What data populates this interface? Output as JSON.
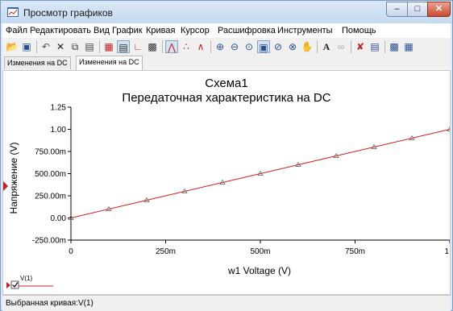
{
  "window": {
    "title": "Просмотр графиков"
  },
  "menu": [
    "Файл",
    "Редактировать",
    "Вид",
    "График",
    "Кривая",
    "Курсор",
    "Расшифровка",
    "Инструменты",
    "Помощь"
  ],
  "tabs": [
    "Изменения на DC",
    "Изменения на DC"
  ],
  "graph": {
    "title": "Схема1",
    "subtitle": "Передаточная характеристика на DC",
    "legend_label": "V(1)"
  },
  "status": "Выбранная кривая:V(1)",
  "colors": {
    "trace": "#d42020",
    "marker_left": "#c0202a"
  },
  "chart_data": {
    "type": "line",
    "title": "Схема1\nПередаточная характеристика на DC",
    "xlabel": "w1 Voltage (V)",
    "ylabel": "Напряжение (V)",
    "xlim": [
      0,
      1
    ],
    "ylim": [
      -0.25,
      1.25
    ],
    "x_ticks": [
      0,
      0.25,
      0.5,
      0.75,
      1
    ],
    "x_tick_labels": [
      "0",
      "250m",
      "500m",
      "750m",
      "1"
    ],
    "y_ticks": [
      -0.25,
      0,
      0.25,
      0.5,
      0.75,
      1,
      1.25
    ],
    "y_tick_labels": [
      "-250.00m",
      "0.00",
      "250.00m",
      "500.00m",
      "750.00m",
      "1.00",
      "1.25"
    ],
    "grid": false,
    "legend": "bottom-left",
    "series": [
      {
        "name": "V(1)",
        "x": [
          0,
          0.1,
          0.2,
          0.3,
          0.4,
          0.5,
          0.6,
          0.7,
          0.8,
          0.9,
          1.0
        ],
        "y": [
          0,
          0.1,
          0.2,
          0.3,
          0.4,
          0.5,
          0.6,
          0.7,
          0.8,
          0.9,
          1.0
        ]
      }
    ]
  }
}
